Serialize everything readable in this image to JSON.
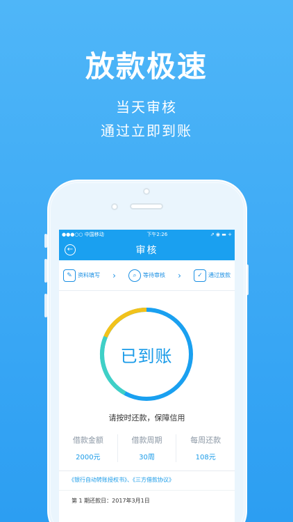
{
  "promo": {
    "headline": "放款极速",
    "line1": "当天审核",
    "line2": "通过立即到账"
  },
  "status_bar": {
    "carrier": "●●●○○ 中国移动 ",
    "time": "下午2:26",
    "right": "⇗ ◉ ▬ +"
  },
  "nav": {
    "back_icon": "back-arrow-icon",
    "title": "审核"
  },
  "steps": [
    {
      "icon": "edit-form-icon",
      "label": "资料填写"
    },
    {
      "icon": "search-review-icon",
      "label": "等待审核"
    },
    {
      "icon": "approved-check-icon",
      "label": "通过放款"
    }
  ],
  "ring": {
    "label": "已到账",
    "colors": {
      "primary": "#1aa0f0",
      "secondary": "#3fd0c6",
      "accent": "#f2c21b"
    }
  },
  "notice": "请按时还款，保障信用",
  "metrics": [
    {
      "label": "借款金额",
      "value": "2000元"
    },
    {
      "label": "借款周期",
      "value": "30周"
    },
    {
      "label": "每周还款",
      "value": "108元"
    }
  ],
  "agreement": "《银行自动转账授权书》、《三方借款协议》",
  "repayment": "第 1 期还款日：2017年3月1日"
}
